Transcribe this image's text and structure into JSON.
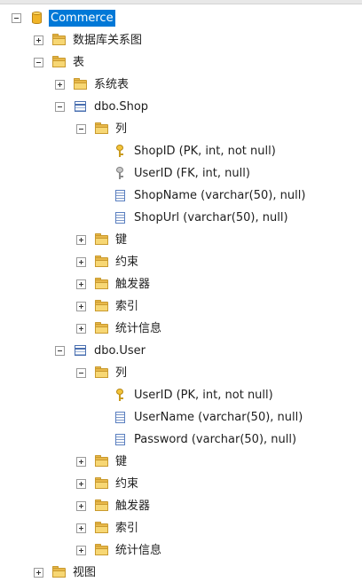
{
  "tree": {
    "root_label": "Commerce",
    "diagram_folder": "数据库关系图",
    "tables_folder": "表",
    "system_tables_folder": "系统表",
    "shop_table": {
      "name": "dbo.Shop",
      "columns_folder": "列",
      "columns": [
        "ShopID (PK, int, not null)",
        "UserID (FK, int, null)",
        "ShopName (varchar(50), null)",
        "ShopUrl (varchar(50), null)"
      ],
      "keys_folder": "键",
      "constraints_folder": "约束",
      "triggers_folder": "触发器",
      "indexes_folder": "索引",
      "statistics_folder": "统计信息"
    },
    "user_table": {
      "name": "dbo.User",
      "columns_folder": "列",
      "columns": [
        "UserID (PK, int, not null)",
        "UserName (varchar(50), null)",
        "Password (varchar(50), null)"
      ],
      "keys_folder": "键",
      "constraints_folder": "约束",
      "triggers_folder": "触发器",
      "indexes_folder": "索引",
      "statistics_folder": "统计信息"
    },
    "views_folder": "视图"
  },
  "icons": {
    "root": "database-icon",
    "folder": "folder-icon",
    "table": "table-icon",
    "primary_key": "primary-key-icon",
    "foreign_key": "foreign-key-icon",
    "column": "column-icon"
  },
  "colors": {
    "selection": "#0078d7",
    "folder": "#f7d774",
    "key_gold": "#f3c43a",
    "key_gray": "#c7c7c7"
  }
}
